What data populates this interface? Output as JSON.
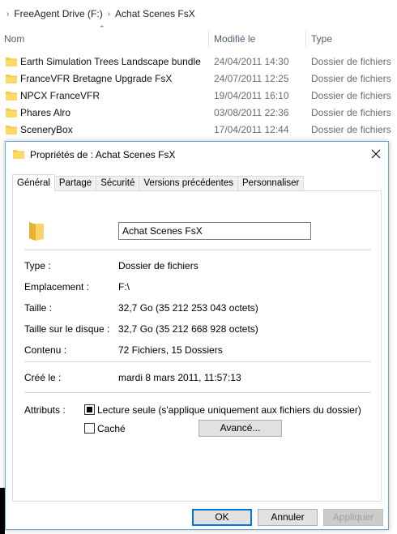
{
  "explorer": {
    "breadcrumb": [
      "FreeAgent Drive (F:)",
      "Achat Scenes FsX"
    ],
    "columns": {
      "name": "Nom",
      "date": "Modifié le",
      "type": "Type"
    },
    "rows": [
      {
        "name": "Earth Simulation Trees Landscape bundle",
        "date": "24/04/2011 14:30",
        "type": "Dossier de fichiers"
      },
      {
        "name": "FranceVFR Bretagne Upgrade FsX",
        "date": "24/07/2011 12:25",
        "type": "Dossier de fichiers"
      },
      {
        "name": "NPCX FranceVFR",
        "date": "19/04/2011 16:10",
        "type": "Dossier de fichiers"
      },
      {
        "name": "Phares Alro",
        "date": "03/08/2011 22:36",
        "type": "Dossier de fichiers"
      },
      {
        "name": "SceneryBox",
        "date": "17/04/2011 12:44",
        "type": "Dossier de fichiers"
      }
    ],
    "folder_color": "#f3c94e"
  },
  "dialog": {
    "title": "Propriétés de : Achat Scenes FsX",
    "tabs": [
      "Général",
      "Partage",
      "Sécurité",
      "Versions précédentes",
      "Personnaliser"
    ],
    "active_tab": "Général",
    "folder_name": "Achat Scenes FsX",
    "fields": {
      "type_label": "Type :",
      "type_value": "Dossier de fichiers",
      "location_label": "Emplacement :",
      "location_value": "F:\\",
      "size_label": "Taille :",
      "size_value": "32,7 Go (35 212 253 043 octets)",
      "disk_size_label": "Taille sur le disque :",
      "disk_size_value": "32,7 Go (35 212 668 928 octets)",
      "contents_label": "Contenu :",
      "contents_value": "72 Fichiers, 15 Dossiers",
      "created_label": "Créé le :",
      "created_value": "mardi 8 mars 2011, 11:57:13",
      "attributes_label": "Attributs :",
      "readonly_label": "Lecture seule (s'applique uniquement aux fichiers du dossier)",
      "hidden_label": "Caché"
    },
    "advanced_button": "Avancé...",
    "ok_button": "OK",
    "cancel_button": "Annuler",
    "apply_button": "Appliquer",
    "accent": "#0078d7"
  }
}
